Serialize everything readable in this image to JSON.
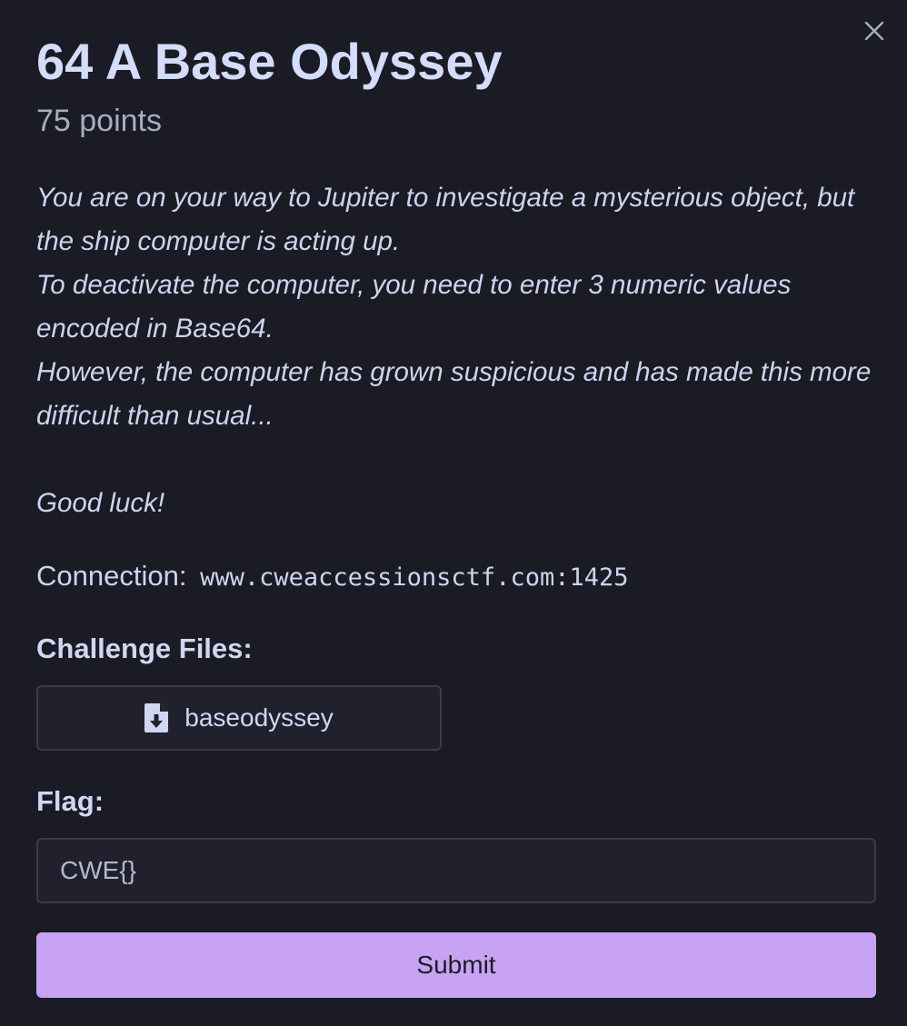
{
  "challenge": {
    "title": "64 A Base Odyssey",
    "points": "75 points"
  },
  "description": {
    "lines": [
      "You are on your way to Jupiter to investigate a mysterious object, but the ship computer is acting up.",
      "To deactivate the computer, you need to enter 3 numeric values encoded in Base64.",
      "However, the computer has grown suspicious and has made this more difficult than usual...",
      "Good luck!"
    ]
  },
  "connection": {
    "label": "Connection:",
    "address": "www.cweaccessionsctf.com:1425"
  },
  "files": {
    "label": "Challenge Files:",
    "items": [
      {
        "name": "baseodyssey",
        "icon": "file-download-icon"
      }
    ]
  },
  "flag": {
    "label": "Flag:",
    "placeholder": "CWE{}",
    "value": ""
  },
  "submit": {
    "label": "Submit"
  },
  "colors": {
    "background": "#1b1b25",
    "accent": "#c9a3f3",
    "text": "#cfd6f2"
  }
}
